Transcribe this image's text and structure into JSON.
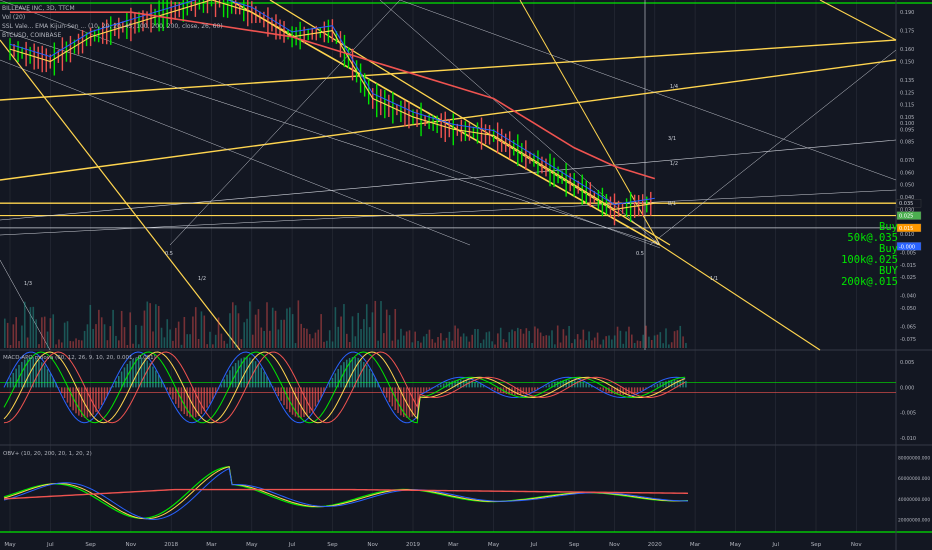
{
  "header": {
    "title": "BILLEAVE INC, 3D, TTCM",
    "indicators": [
      "Vol (20)",
      "SSL Vale... EMA Kijun-Sen ... (10, 20, 20, 45, 100, 200, 200, close, 26, 60)",
      "BTCUSD, COINBASE"
    ]
  },
  "colors": {
    "background": "#131722",
    "grid": "#2a2e39",
    "axis_text": "#b2b5be",
    "green": "#26a69a",
    "bright_green": "#00e600",
    "red": "#ef5350",
    "yellow": "#ffd54f",
    "blue": "#2962ff",
    "white": "#d1d4dc"
  },
  "annotations": {
    "buy_lines": [
      "Buy 50k@.035",
      "Buy 100k@.025",
      "BUY 200k@.015"
    ],
    "fib_labels": [
      "1/3",
      "1/2",
      "1/1",
      "1/4",
      "3/1",
      "1/2",
      "8/1",
      "0.5",
      "0.5",
      "0"
    ]
  },
  "chart_data": [
    {
      "type": "line",
      "name": "price",
      "x": [
        "May",
        "Jul",
        "Sep",
        "Nov",
        "2018",
        "Mar",
        "May",
        "Jul",
        "Sep",
        "Nov",
        "2019",
        "Mar",
        "May",
        "Jul",
        "Sep",
        "Nov",
        "2020",
        "Mar",
        "May",
        "Jul",
        "Sep",
        "Nov"
      ],
      "series": [
        {
          "name": "",
          "values": [
            0.16,
            0.15,
            0.17,
            0.18,
            0.19,
            0.2,
            0.19,
            0.17,
            0.175,
            0.12,
            0.105,
            0.095,
            0.09,
            0.07,
            0.05,
            0.03,
            0.035,
            null,
            null,
            null,
            null,
            null
          ]
        },
        {
          "name": "",
          "values": [
            0.19,
            0.19,
            0.19,
            0.19,
            0.185,
            0.18,
            0.175,
            0.17,
            0.16,
            0.15,
            0.14,
            0.13,
            0.12,
            0.1,
            0.08,
            0.065,
            0.055,
            null,
            null,
            null,
            null,
            null
          ]
        }
      ],
      "y_ticks": [
        "0.190",
        "0.175",
        "0.160",
        "0.150",
        "0.135",
        "0.125",
        "0.115",
        "0.105",
        "0.100",
        "0.095",
        "0.085",
        "0.070",
        "0.060",
        "0.050",
        "0.040",
        "0.030",
        "0.025",
        "0.015",
        "0.010",
        "-0.005",
        "-0.015",
        "-0.025",
        "-0.040",
        "-0.050",
        "-0.065",
        "-0.075"
      ],
      "price_tags": [
        "0.035",
        "0.025",
        "0.015",
        "-0.000"
      ],
      "ylim": [
        -0.08,
        0.195
      ]
    },
    {
      "type": "line",
      "name": "MACD-APO mnova (60, 12, 26, 9, 10, 20, 0.001, -0.001)",
      "y_ticks": [
        "0.005",
        "0.000",
        "-0.005",
        "-0.010"
      ],
      "ylim": [
        -0.011,
        0.007
      ]
    },
    {
      "type": "line",
      "name": "OBV+ (10, 20, 200, 20, 1, 20, 2)",
      "y_ticks": [
        "80000000.000",
        "60000000.000",
        "40000000.000",
        "20000000.000"
      ],
      "ylim": [
        10000000,
        90000000
      ]
    }
  ]
}
